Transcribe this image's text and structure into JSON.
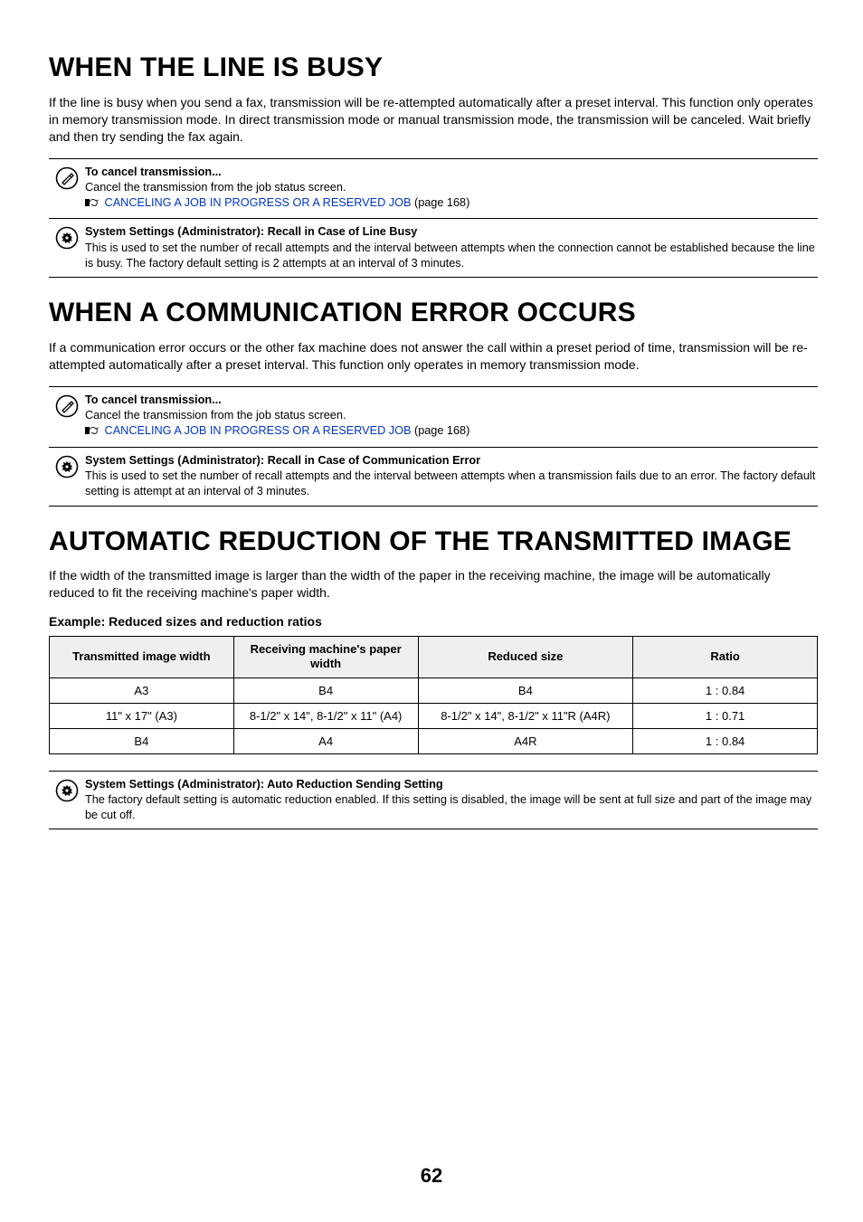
{
  "sections": {
    "busy": {
      "heading": "WHEN THE LINE IS BUSY",
      "body": "If the line is busy when you send a fax, transmission will be re-attempted automatically after a preset interval. This function only operates in memory transmission mode. In direct transmission mode or manual transmission mode, the transmission will be canceled. Wait briefly and then try sending the fax again.",
      "note1": {
        "title": "To cancel transmission...",
        "line": "Cancel the transmission from the job status screen.",
        "link": "CANCELING A JOB IN PROGRESS OR A RESERVED JOB",
        "pageref": " (page 168)"
      },
      "note2": {
        "title": "System Settings (Administrator): Recall in Case of Line Busy",
        "body": "This is used to set the number of recall attempts and the interval between attempts when the connection cannot be established because the line is busy. The factory default setting is 2 attempts at an interval of 3 minutes."
      }
    },
    "error": {
      "heading": "WHEN A COMMUNICATION ERROR OCCURS",
      "body": "If a communication error occurs or the other fax machine does not answer the call within a preset period of time, transmission will be re-attempted automatically after a preset interval. This function only operates in memory transmission mode.",
      "note1": {
        "title": "To cancel transmission...",
        "line": "Cancel the transmission from the job status screen.",
        "link": "CANCELING A JOB IN PROGRESS OR A RESERVED JOB",
        "pageref": " (page 168)"
      },
      "note2": {
        "title": "System Settings (Administrator): Recall in Case of Communication Error",
        "body": "This is used to set the number of recall attempts and the interval between attempts when a transmission fails due to an error. The factory default setting is attempt at an interval of 3 minutes."
      }
    },
    "reduce": {
      "heading": "AUTOMATIC REDUCTION OF THE TRANSMITTED IMAGE",
      "body": "If the width of the transmitted image is larger than the width of the paper in the receiving machine, the image will be automatically reduced to fit the receiving machine's paper width.",
      "table_caption": "Example: Reduced sizes and reduction ratios",
      "note": {
        "title": "System Settings (Administrator): Auto Reduction Sending Setting",
        "body": "The factory default setting is automatic reduction enabled. If this setting is disabled, the image will be sent at full size and part of the image may be cut off."
      }
    }
  },
  "table": {
    "headers": {
      "c1": "Transmitted image width",
      "c2": "Receiving machine's paper width",
      "c3": "Reduced size",
      "c4": "Ratio"
    },
    "rows": [
      {
        "c1": "A3",
        "c2": "B4",
        "c3": "B4",
        "c4": "1 : 0.84"
      },
      {
        "c1": "11\" x 17\" (A3)",
        "c2": "8-1/2\" x 14\", 8-1/2\" x 11\" (A4)",
        "c3": "8-1/2\" x 14\", 8-1/2\" x 11\"R (A4R)",
        "c4": "1 : 0.71"
      },
      {
        "c1": "B4",
        "c2": "A4",
        "c3": "A4R",
        "c4": "1 : 0.84"
      }
    ]
  },
  "chart_data": {
    "type": "table",
    "title": "Example: Reduced sizes and reduction ratios",
    "headers": [
      "Transmitted image width",
      "Receiving machine's paper width",
      "Reduced size",
      "Ratio"
    ],
    "rows": [
      [
        "A3",
        "B4",
        "B4",
        "1 : 0.84"
      ],
      [
        "11\" x 17\" (A3)",
        "8-1/2\" x 14\", 8-1/2\" x 11\" (A4)",
        "8-1/2\" x 14\", 8-1/2\" x 11\"R (A4R)",
        "1 : 0.71"
      ],
      [
        "B4",
        "A4",
        "A4R",
        "1 : 0.84"
      ]
    ]
  },
  "page_number": "62"
}
